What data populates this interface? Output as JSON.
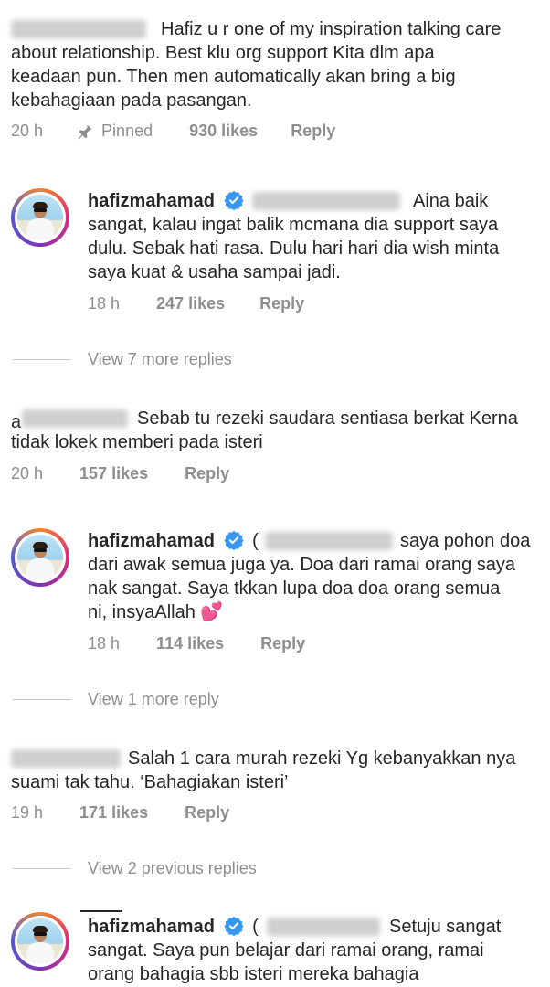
{
  "comment1": {
    "text_line1": "Hafiz u r one of my inspiration talking care",
    "text_line2": "about relationship.  Best klu org support Kita dlm apa",
    "text_line3": "keadaan pun. Then men automatically akan bring a big",
    "text_line4": "kebahagiaan pada pasangan.",
    "time": "20 h",
    "pinned": "Pinned",
    "likes": "930 likes",
    "reply": "Reply"
  },
  "reply1": {
    "username": "hafizmahamad",
    "text_line1": "Aina baik",
    "text_line2": "sangat, kalau ingat balik mcmana dia support saya",
    "text_line3": "dulu. Sebak hati rasa. Dulu hari hari dia wish minta",
    "text_line4": "saya kuat & usaha sampai jadi.",
    "time": "18 h",
    "likes": "247 likes",
    "reply": "Reply"
  },
  "view1": "View 7 more replies",
  "comment2": {
    "prefix": "a",
    "text_line1": "Sebab tu rezeki saudara sentiasa berkat Kerna",
    "text_line2": "tidak lokek memberi pada isteri",
    "time": "20 h",
    "likes": "157 likes",
    "reply": "Reply"
  },
  "reply2": {
    "username": "hafizmahamad",
    "paren": "(",
    "text_line1": "saya pohon doa",
    "text_line2": "dari awak semua juga ya. Doa dari ramai orang saya",
    "text_line3": "nak sangat. Saya tkkan lupa doa doa orang semua",
    "text_line4": "ni, insyaAllah 💕",
    "time": "18 h",
    "likes": "114 likes",
    "reply": "Reply"
  },
  "view2": "View 1 more reply",
  "comment3": {
    "text_line1": "Salah 1 cara murah rezeki Yg kebanyakkan nya",
    "text_line2": "suami tak tahu. ‘Bahagiakan isteri’",
    "time": "19 h",
    "likes": "171 likes",
    "reply": "Reply"
  },
  "view3": "View 2 previous replies",
  "reply3": {
    "username": "hafizmahamad",
    "paren": "(",
    "text_line1": "Setuju sangat",
    "text_line2": "sangat. Saya pun belajar dari ramai orang, ramai",
    "text_line3": "orang bahagia sbb isteri mereka bahagia"
  },
  "colors": {
    "text": "#262626",
    "meta": "#8e8e8e",
    "verified": "#3897f0"
  },
  "icons": [
    "pin-icon",
    "verified-badge-icon",
    "avatar"
  ]
}
